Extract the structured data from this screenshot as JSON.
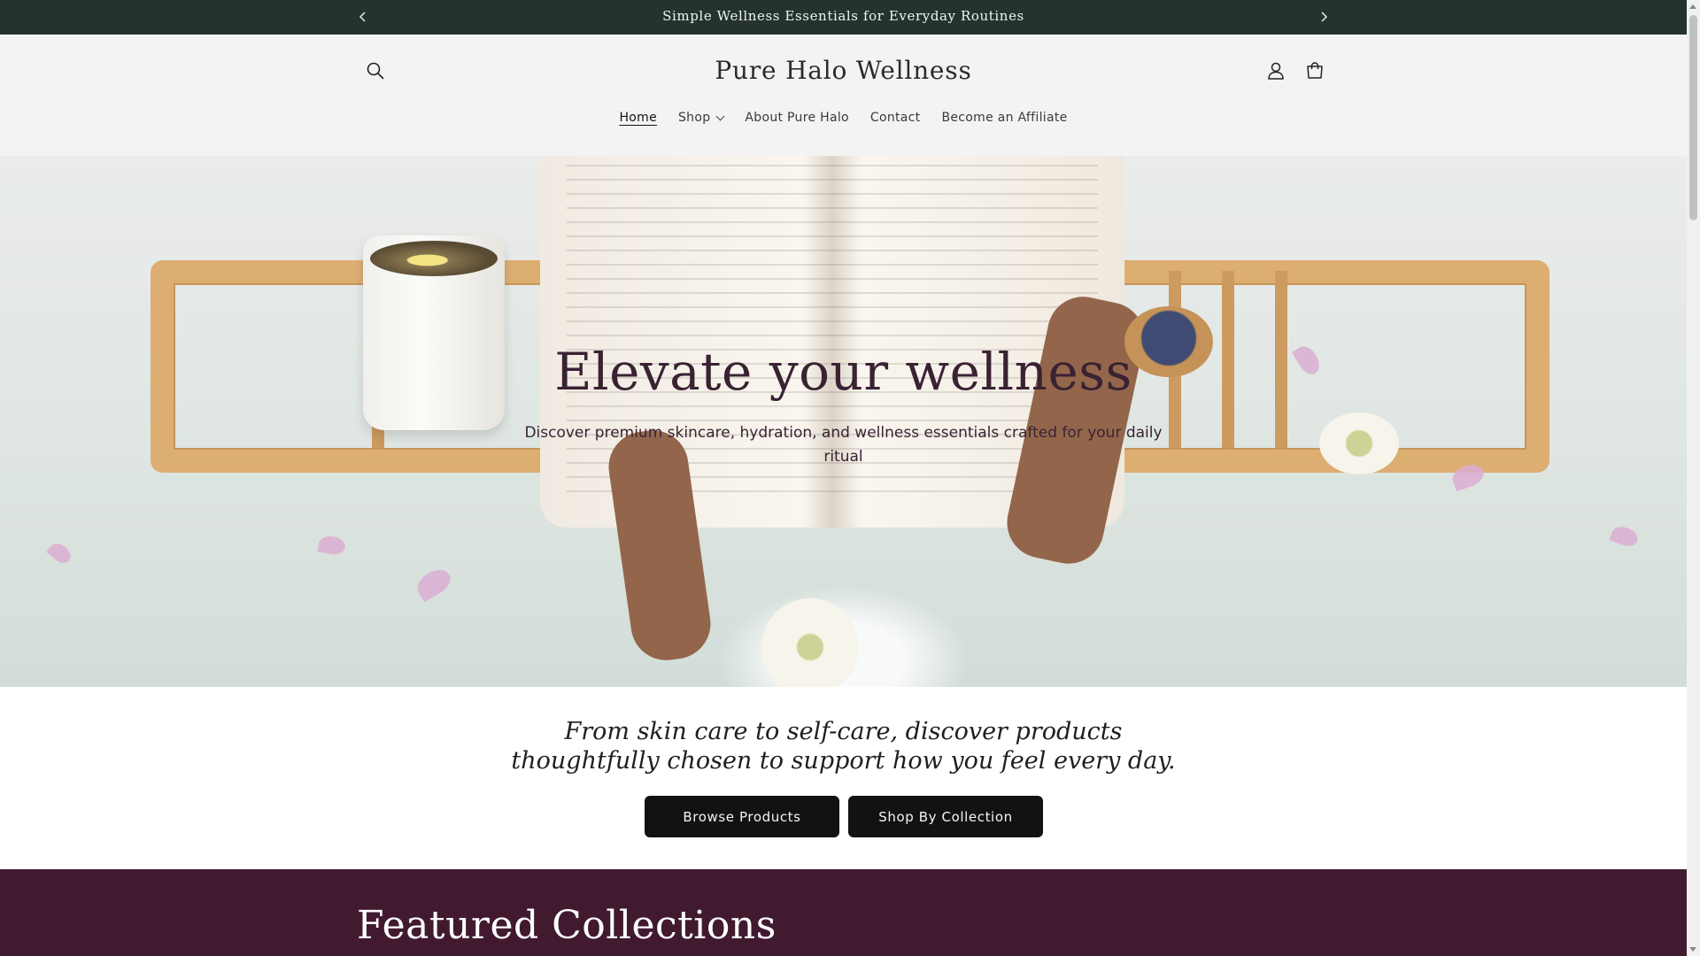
{
  "announcement": {
    "text": "Simple Wellness Essentials for Everyday Routines",
    "prev_icon": "chevron-left-icon",
    "next_icon": "chevron-right-icon"
  },
  "header": {
    "logo": "Pure Halo Wellness",
    "search_icon": "search-icon",
    "account_icon": "account-icon",
    "cart_icon": "cart-icon"
  },
  "nav": {
    "items": [
      {
        "label": "Home",
        "active": true
      },
      {
        "label": "Shop",
        "has_dropdown": true
      },
      {
        "label": "About Pure Halo"
      },
      {
        "label": "Contact"
      },
      {
        "label": "Become an Affiliate"
      }
    ]
  },
  "hero": {
    "title": "Elevate your wellness",
    "subtitle": "Discover premium skincare, hydration, and wellness essentials crafted for your daily ritual"
  },
  "intro": {
    "tagline": "From skin care to self-care, discover products thoughtfully chosen to support how you feel every day.",
    "browse_button": "Browse Products",
    "collection_button": "Shop By Collection"
  },
  "featured": {
    "title": "Featured Collections"
  },
  "colors": {
    "announcement_bg": "#243330",
    "header_bg": "#f3f3f3",
    "button_bg": "#121212",
    "featured_bg": "#411a30",
    "hero_text": "#3a2233"
  }
}
